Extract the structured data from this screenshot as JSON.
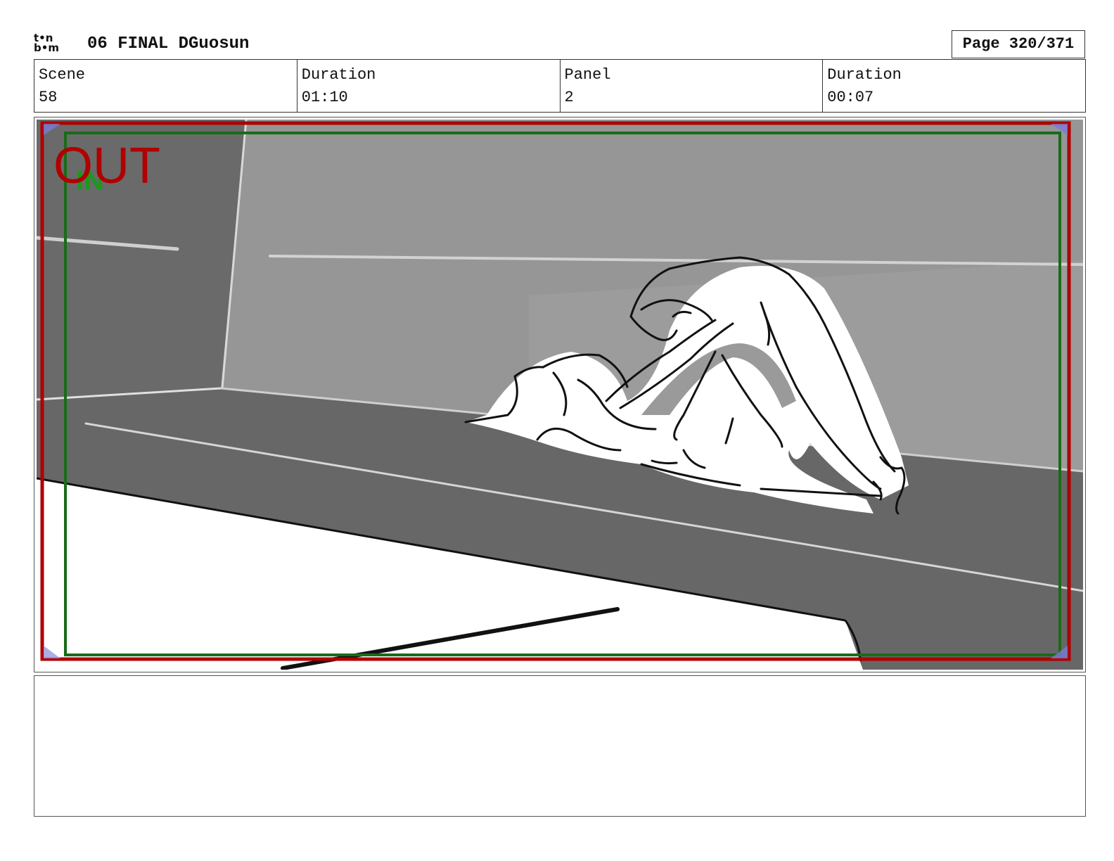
{
  "header": {
    "logo_top": "t•n",
    "logo_bottom": "b•m",
    "title": "06 FINAL DGuosun",
    "page_label": "Page 320/371"
  },
  "info": {
    "scene_label": "Scene",
    "scene_value": "58",
    "scene_duration_label": "Duration",
    "scene_duration_value": "01:10",
    "panel_label": "Panel",
    "panel_value": "2",
    "panel_duration_label": "Duration",
    "panel_duration_value": "00:07"
  },
  "panel": {
    "out_label": "OUT",
    "in_label": "IN",
    "out_color": "#b00000",
    "in_color": "#1a6b1a"
  },
  "notes": {
    "text": ""
  }
}
